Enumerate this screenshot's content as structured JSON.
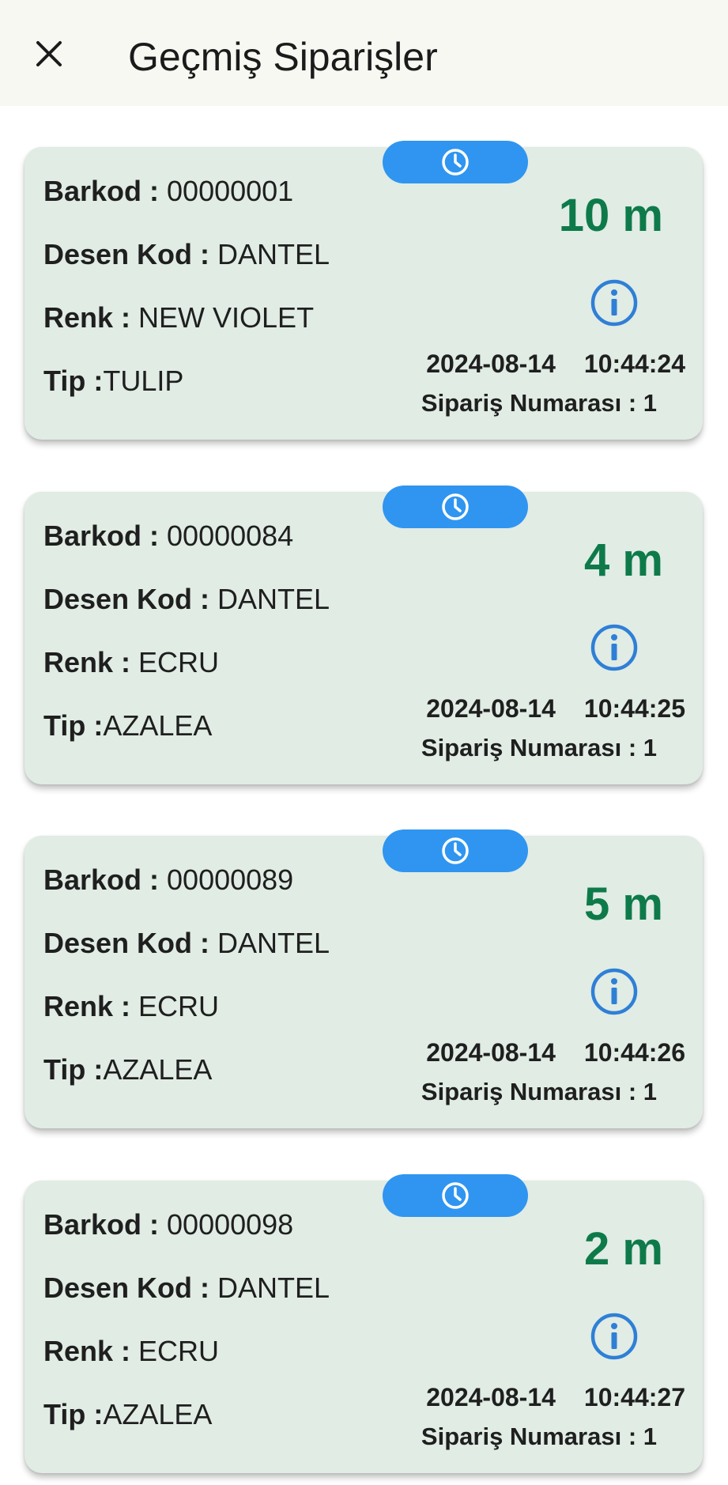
{
  "header": {
    "title": "Geçmiş Siparişler",
    "close_icon": "close-icon"
  },
  "labels": {
    "barkod": "Barkod : ",
    "desen_kod": "Desen Kod : ",
    "renk": "Renk : ",
    "tip": "Tip :"
  },
  "colors": {
    "card_bg": "#e0ece4",
    "pill": "#2f95f0",
    "quantity": "#0e7a4a",
    "info_icon": "#2f7fd6"
  },
  "orders": [
    {
      "barkod": "00000001",
      "desen_kod": "DANTEL",
      "renk": "NEW VIOLET",
      "tip": "TULIP",
      "quantity": "10 m",
      "date": "2024-08-14",
      "time": "10:44:24",
      "order_number": "Sipariş Numarası : 1"
    },
    {
      "barkod": "00000084",
      "desen_kod": "DANTEL",
      "renk": "ECRU",
      "tip": "AZALEA",
      "quantity": "4 m",
      "date": "2024-08-14",
      "time": "10:44:25",
      "order_number": "Sipariş Numarası : 1"
    },
    {
      "barkod": "00000089",
      "desen_kod": "DANTEL",
      "renk": "ECRU",
      "tip": "AZALEA",
      "quantity": "5 m",
      "date": "2024-08-14",
      "time": "10:44:26",
      "order_number": "Sipariş Numarası : 1"
    },
    {
      "barkod": "00000098",
      "desen_kod": "DANTEL",
      "renk": "ECRU",
      "tip": "AZALEA",
      "quantity": "2 m",
      "date": "2024-08-14",
      "time": "10:44:27",
      "order_number": "Sipariş Numarası : 1"
    }
  ]
}
